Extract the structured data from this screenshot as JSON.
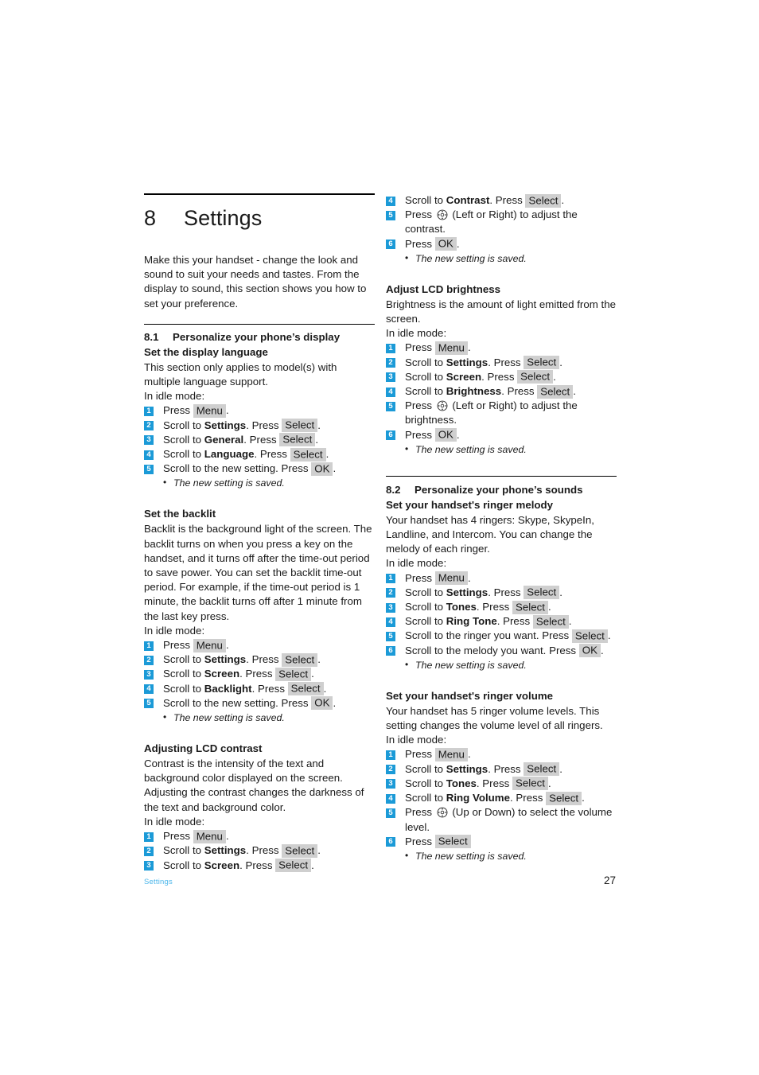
{
  "document": {
    "chapter_number": "8",
    "chapter_title": "Settings",
    "intro": "Make this your handset - change the look and sound to suit your needs and tastes. From the display to sound, this section shows you how to set your preference."
  },
  "icons": {
    "nav_pad": "navigation-pad-icon"
  },
  "colors": {
    "badge_blue": "#1b9ad7",
    "keycap_gray": "#cfcfcf",
    "footer_blue": "#49b5ea",
    "text": "#1a1a1a"
  },
  "section_81": {
    "number": "8.1",
    "title": "Personalize your phone’s display",
    "display_language": {
      "heading": "Set the display language",
      "body": "This section only applies to model(s) with multiple language support.",
      "idle": "In idle mode:",
      "steps": [
        {
          "n": "1",
          "pre": "Press ",
          "key": "Menu",
          "post": "."
        },
        {
          "n": "2",
          "pre": "Scroll to ",
          "bold": "Settings",
          "mid": ". Press ",
          "key": "Select",
          "post": "."
        },
        {
          "n": "3",
          "pre": "Scroll to ",
          "bold": "General",
          "mid": ". Press ",
          "key": "Select",
          "post": "."
        },
        {
          "n": "4",
          "pre": "Scroll to ",
          "bold": "Language",
          "mid": ". Press ",
          "key": "Select",
          "post": "."
        },
        {
          "n": "5",
          "pre": "Scroll to the new setting. Press ",
          "key": "OK",
          "post": "."
        }
      ],
      "note": "The new setting is saved."
    },
    "backlit": {
      "heading": "Set the backlit",
      "body": "Backlit is the background light of the screen. The backlit turns on when you press a key on the handset, and it turns off after the time-out period to save power. You can set the backlit time-out period. For example, if the time-out period is 1 minute, the backlit turns off after 1 minute from the last key press.",
      "idle": "In idle mode:",
      "steps": [
        {
          "n": "1",
          "pre": "Press ",
          "key": "Menu",
          "post": "."
        },
        {
          "n": "2",
          "pre": "Scroll to ",
          "bold": "Settings",
          "mid": ". Press ",
          "key": "Select",
          "post": "."
        },
        {
          "n": "3",
          "pre": "Scroll to ",
          "bold": "Screen",
          "mid": ". Press ",
          "key": "Select",
          "post": "."
        },
        {
          "n": "4",
          "pre": "Scroll to ",
          "bold": "Backlight",
          "mid": ". Press ",
          "key": "Select",
          "post": "."
        },
        {
          "n": "5",
          "pre": "Scroll to the new setting. Press ",
          "key": "OK",
          "post": "."
        }
      ],
      "note": "The new setting is saved."
    },
    "contrast": {
      "heading": "Adjusting LCD contrast",
      "body": "Contrast is the intensity of the text and background color displayed on the screen. Adjusting the contrast changes the darkness of the text and background color.",
      "idle": "In idle mode:",
      "steps_left": [
        {
          "n": "1",
          "pre": "Press ",
          "key": "Menu",
          "post": "."
        },
        {
          "n": "2",
          "pre": "Scroll to ",
          "bold": "Settings",
          "mid": ". Press ",
          "key": "Select",
          "post": "."
        },
        {
          "n": "3",
          "pre": "Scroll to ",
          "bold": "Screen",
          "mid": ". Press ",
          "key": "Select",
          "post": "."
        }
      ],
      "steps_right": [
        {
          "n": "4",
          "pre": "Scroll to ",
          "bold": "Contrast",
          "mid": ". Press ",
          "key": "Select",
          "post": "."
        },
        {
          "n": "5",
          "pre": "Press ",
          "icon": "navigation-pad-icon",
          "post": " (Left or Right) to adjust the contrast."
        },
        {
          "n": "6",
          "pre": "Press ",
          "key": "OK",
          "post": "."
        }
      ],
      "note": "The new setting is saved."
    },
    "brightness": {
      "heading": "Adjust LCD brightness",
      "body": "Brightness is the amount of light emitted from the screen.",
      "idle": "In idle mode:",
      "steps": [
        {
          "n": "1",
          "pre": "Press ",
          "key": "Menu",
          "post": "."
        },
        {
          "n": "2",
          "pre": "Scroll to ",
          "bold": "Settings",
          "mid": ". Press ",
          "key": "Select",
          "post": "."
        },
        {
          "n": "3",
          "pre": "Scroll to ",
          "bold": "Screen",
          "mid": ". Press ",
          "key": "Select",
          "post": "."
        },
        {
          "n": "4",
          "pre": "Scroll to ",
          "bold": "Brightness",
          "mid": ". Press ",
          "key": "Select",
          "post": "."
        },
        {
          "n": "5",
          "pre": "Press ",
          "icon": "navigation-pad-icon",
          "post": " (Left or Right) to adjust the brightness."
        },
        {
          "n": "6",
          "pre": "Press ",
          "key": "OK",
          "post": "."
        }
      ],
      "note": "The new setting is saved."
    }
  },
  "section_82": {
    "number": "8.2",
    "title": "Personalize your phone’s sounds",
    "ringer_melody": {
      "heading": "Set your handset's ringer melody",
      "body": "Your handset has 4 ringers: Skype, SkypeIn, Landline, and Intercom. You can change the melody of each ringer.",
      "idle": "In idle mode:",
      "steps": [
        {
          "n": "1",
          "pre": "Press ",
          "key": "Menu",
          "post": "."
        },
        {
          "n": "2",
          "pre": "Scroll to ",
          "bold": "Settings",
          "mid": ". Press ",
          "key": "Select",
          "post": "."
        },
        {
          "n": "3",
          "pre": "Scroll to ",
          "bold": "Tones",
          "mid": ". Press ",
          "key": "Select",
          "post": "."
        },
        {
          "n": "4",
          "pre": "Scroll to ",
          "bold": "Ring Tone",
          "mid": ". Press ",
          "key": "Select",
          "post": "."
        },
        {
          "n": "5",
          "pre": "Scroll to the ringer you want. Press ",
          "key": "Select",
          "post": "."
        },
        {
          "n": "6",
          "pre": "Scroll to the melody you want. Press ",
          "key": "OK",
          "post": "."
        }
      ],
      "note": "The new setting is saved."
    },
    "ringer_volume": {
      "heading": "Set your handset's ringer volume",
      "body": "Your handset has 5 ringer volume levels. This setting changes the volume level of all ringers.",
      "idle": "In idle mode:",
      "steps": [
        {
          "n": "1",
          "pre": "Press ",
          "key": "Menu",
          "post": "."
        },
        {
          "n": "2",
          "pre": "Scroll to ",
          "bold": "Settings",
          "mid": ". Press ",
          "key": "Select",
          "post": "."
        },
        {
          "n": "3",
          "pre": "Scroll to ",
          "bold": "Tones",
          "mid": ". Press ",
          "key": "Select",
          "post": "."
        },
        {
          "n": "4",
          "pre": "Scroll to ",
          "bold": "Ring Volume",
          "mid": ". Press ",
          "key": "Select",
          "post": "."
        },
        {
          "n": "5",
          "pre": "Press ",
          "icon": "navigation-pad-icon",
          "post": " (Up or Down) to select the volume level."
        },
        {
          "n": "6",
          "pre": "Press ",
          "key": "Select",
          "post": ""
        }
      ],
      "note": "The new setting is saved."
    }
  },
  "footer": {
    "left": "Settings",
    "page_number": "27"
  }
}
